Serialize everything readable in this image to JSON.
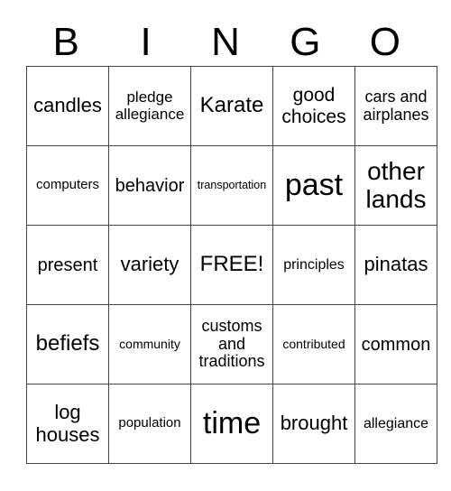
{
  "header": [
    "B",
    "I",
    "N",
    "G",
    "O"
  ],
  "rows": [
    [
      "candles",
      "pledge allegiance",
      "Karate",
      "good choices",
      "cars and airplanes"
    ],
    [
      "computers",
      "behavior",
      "transportation",
      "past",
      "other lands"
    ],
    [
      "present",
      "variety",
      "FREE!",
      "principles",
      "pinatas"
    ],
    [
      "befiefs",
      "community",
      "customs and traditions",
      "contributed",
      "common"
    ],
    [
      "log houses",
      "population",
      "time",
      "brought",
      "allegiance"
    ]
  ]
}
